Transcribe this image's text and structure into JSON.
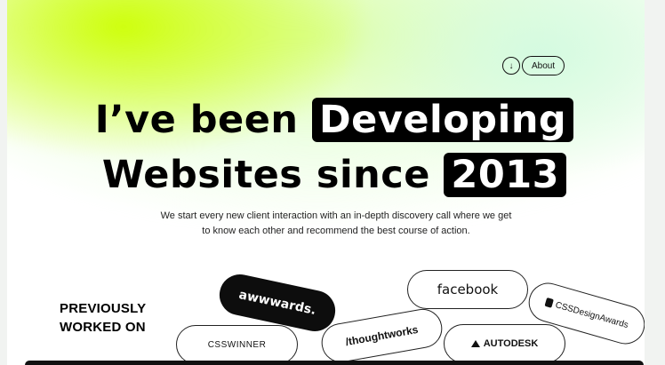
{
  "nav": {
    "down_icon": "↓",
    "about_label": "About"
  },
  "hero": {
    "line1_text": "I’ve been ",
    "line1_highlight": "Developing",
    "line2_text": "Websites since ",
    "line2_highlight": "2013",
    "description_line1": "We start every new client interaction with an in-depth discovery call where we get",
    "description_line2": "to know each other and recommend the best course of action."
  },
  "clients": {
    "heading_line1": "PREVIOUSLY",
    "heading_line2": "WORKED ON",
    "logos": [
      "awwwards.",
      "facebook",
      "CSSDesignAwards",
      "CSSWINNER",
      "/thoughtworks",
      "AUTODESK"
    ]
  },
  "colors": {
    "accent_lime": "#d4ff00",
    "ink": "#000000"
  }
}
